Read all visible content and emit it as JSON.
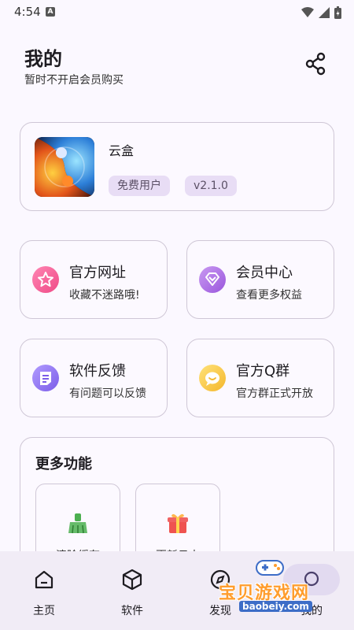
{
  "status_bar": {
    "time": "4:54",
    "a_badge": "A"
  },
  "header": {
    "title": "我的",
    "subtitle": "暂时不开启会员购买",
    "share_icon": "share-icon"
  },
  "app_card": {
    "name": "云盒",
    "user_badge": "免费用户",
    "version": "v2.1.0"
  },
  "features": [
    {
      "title": "官方网址",
      "subtitle": "收藏不迷路哦!",
      "icon": "star-icon",
      "color": "#f0609a"
    },
    {
      "title": "会员中心",
      "subtitle": "查看更多权益",
      "icon": "diamond-icon",
      "color": "#a86ce0"
    },
    {
      "title": "软件反馈",
      "subtitle": "有问题可以反馈",
      "icon": "feedback-icon",
      "color": "#8b6cf0"
    },
    {
      "title": "官方Q群",
      "subtitle": "官方群正式开放",
      "icon": "chat-icon",
      "color": "#f5c542"
    }
  ],
  "more": {
    "title": "更多功能",
    "items": [
      {
        "label": "清除缓存",
        "icon": "broom-icon"
      },
      {
        "label": "更新日志",
        "icon": "gift-icon"
      }
    ]
  },
  "nav": {
    "items": [
      {
        "label": "主页",
        "icon": "home-icon"
      },
      {
        "label": "软件",
        "icon": "box-icon"
      },
      {
        "label": "发现",
        "icon": "compass-icon"
      },
      {
        "label": "我的",
        "icon": "user-icon",
        "active": true
      }
    ]
  },
  "watermark": {
    "text": "宝贝游戏网",
    "url": "baobeiy.com"
  }
}
